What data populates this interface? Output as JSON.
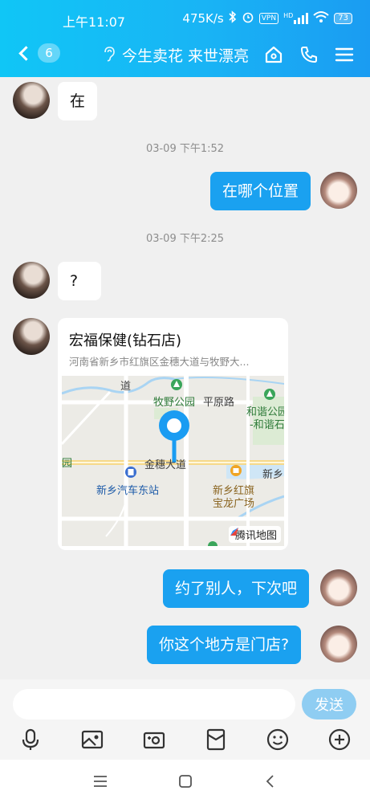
{
  "status_bar": {
    "time": "上午11:07",
    "speed": "475K/s",
    "vpn": "VPN",
    "hd": "HD",
    "battery": "73"
  },
  "nav": {
    "unread_count": "6",
    "title": "今生卖花 来世漂亮",
    "ear_icon": "ear-icon",
    "icons": [
      "home-icon",
      "phone-icon",
      "menu-icon"
    ]
  },
  "messages": [
    {
      "side": "in",
      "text": "在"
    },
    {
      "timestamp": "03-09 下午1:52"
    },
    {
      "side": "out",
      "text": "在哪个位置"
    },
    {
      "timestamp": "03-09 下午2:25"
    },
    {
      "side": "in",
      "text": "?"
    },
    {
      "side": "in",
      "type": "location"
    },
    {
      "side": "out",
      "text": "约了别人，下次吧"
    },
    {
      "side": "out",
      "text": "你这个地方是门店?"
    }
  ],
  "location": {
    "name": "宏福保健(钻石店)",
    "address": "河南省新乡市红旗区金穗大道与牧野大...",
    "map_labels": {
      "dao": "道",
      "park": "牧野公园",
      "road": "平原路",
      "park2_line1": "和谐公园",
      "park2_line2": "-和谐石",
      "avenue": "金穗大道",
      "yuan": "园",
      "xinxiang_right": "新乡",
      "station": "新乡汽车东站",
      "plaza_line1": "新乡红旗",
      "plaza_line2": "宝龙广场"
    },
    "provider": "腾讯地图"
  },
  "input": {
    "placeholder": "",
    "send_label": "发送"
  },
  "toolbar_icons": [
    "microphone-icon",
    "image-icon",
    "camera-icon",
    "red-packet-icon",
    "emoji-icon",
    "plus-icon"
  ],
  "system_nav": [
    "recent-apps-icon",
    "home-button-icon",
    "back-icon"
  ],
  "colors": {
    "header_start": "#10c6f6",
    "header_end": "#1a9cf2",
    "bubble_out": "#1aa1f0",
    "send_button": "#8fcdf2"
  }
}
